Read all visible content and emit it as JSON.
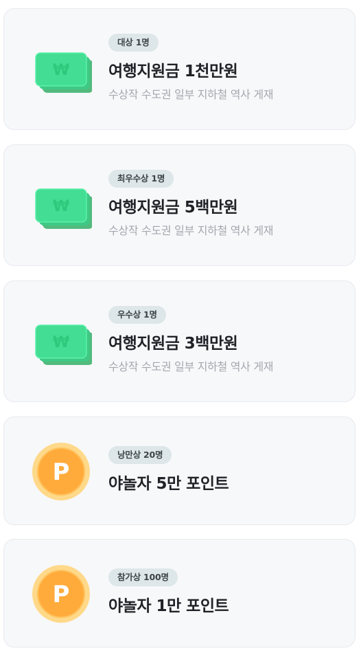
{
  "prizes": [
    {
      "icon": "cash-bundle-icon",
      "badge": "대상 1명",
      "title": "여행지원금 1천만원",
      "desc": "수상작 수도권 일부 지하철 역사 게재",
      "currency_symbol": "₩"
    },
    {
      "icon": "cash-bundle-icon",
      "badge": "최우수상 1명",
      "title": "여행지원금 5백만원",
      "desc": "수상작 수도권 일부 지하철 역사 게재",
      "currency_symbol": "₩"
    },
    {
      "icon": "cash-bundle-icon",
      "badge": "우수상 1명",
      "title": "여행지원금 3백만원",
      "desc": "수상작 수도권 일부 지하철 역사 게재",
      "currency_symbol": "₩"
    },
    {
      "icon": "point-coin-icon",
      "badge": "낭만상 20명",
      "title": "야놀자 5만 포인트",
      "coin_letter": "P"
    },
    {
      "icon": "point-coin-icon",
      "badge": "참가상 100명",
      "title": "야놀자 1만 포인트",
      "coin_letter": "P"
    }
  ],
  "colors": {
    "card_background": "#f7f8fa",
    "card_border": "#e7e9ee",
    "badge_background": "#dde6e8",
    "title_text": "#1f2226",
    "desc_text": "#a3a8ae",
    "cash_green": "#3fd891",
    "coin_orange": "#ffa52f"
  }
}
